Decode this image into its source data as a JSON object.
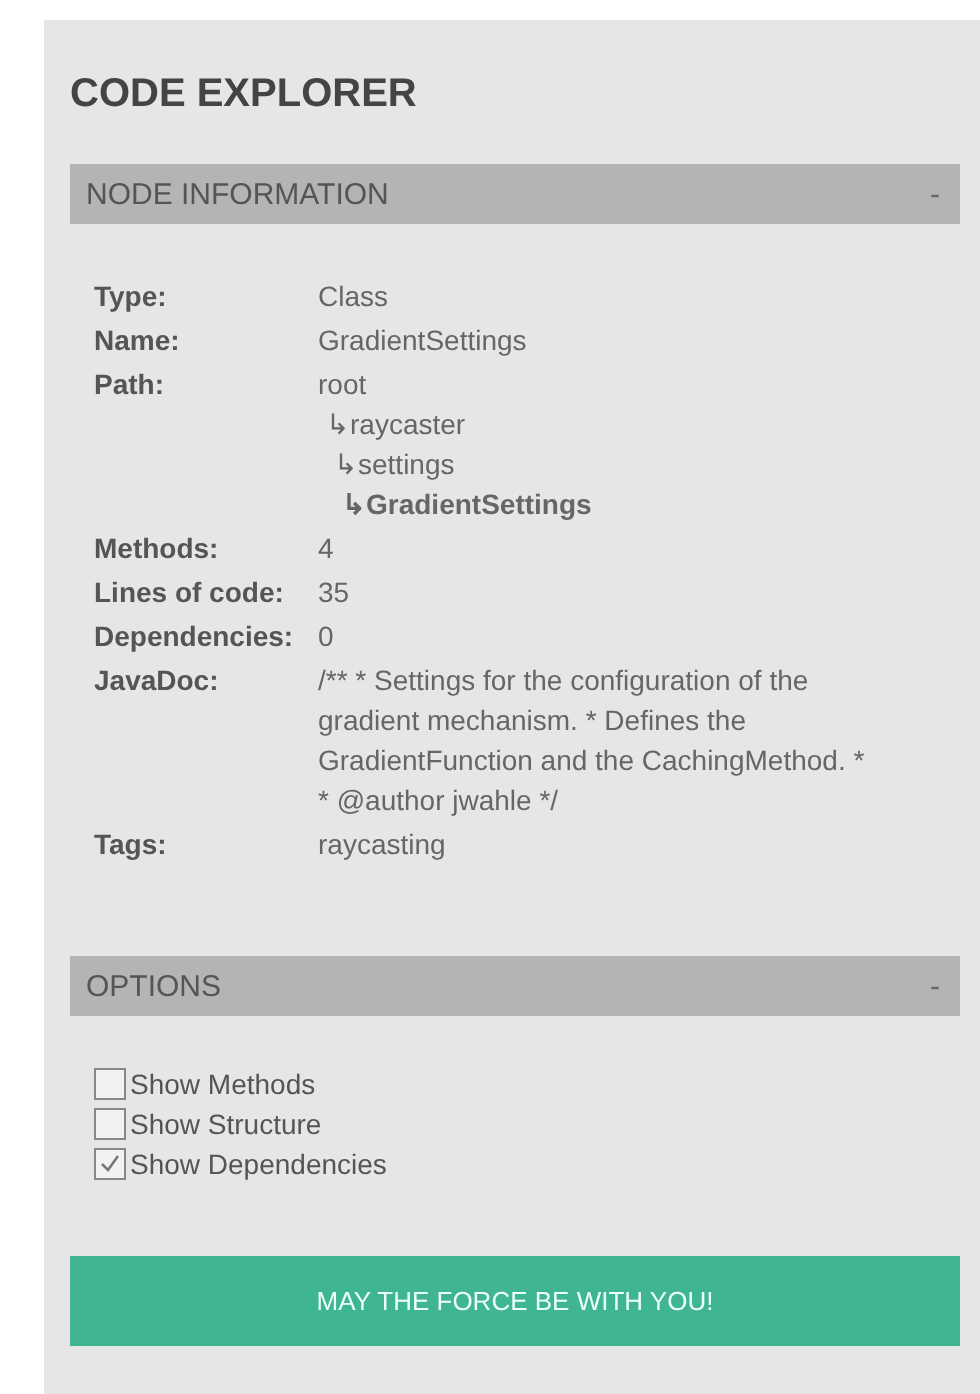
{
  "title": "CODE EXPLORER",
  "node_information": {
    "title": "NODE INFORMATION",
    "toggle": "-",
    "fields": [
      {
        "kind": "text",
        "label": "Type:",
        "value": "Class"
      },
      {
        "kind": "text",
        "label": "Name:",
        "value": "GradientSettings"
      },
      {
        "kind": "path",
        "label": "Path:",
        "path": [
          {
            "name": "root",
            "current": false,
            "children": [
              {
                "name": "↳raycaster",
                "current": false,
                "children": [
                  {
                    "name": "↳settings",
                    "current": false,
                    "children": [
                      {
                        "name": "↳GradientSettings",
                        "current": true
                      }
                    ]
                  }
                ]
              }
            ]
          }
        ]
      },
      {
        "kind": "text",
        "label": "Methods:",
        "value": "4"
      },
      {
        "kind": "text",
        "label": "Lines of code:",
        "value": "35"
      },
      {
        "kind": "text",
        "label": "Dependencies:",
        "value": "0"
      },
      {
        "kind": "text",
        "label": "JavaDoc:",
        "value": "/** * Settings for the configuration of the gradient mechanism. * Defines the GradientFunction and the CachingMethod. * * @author jwahle */"
      },
      {
        "kind": "text",
        "label": "Tags:",
        "value": "raycasting"
      }
    ]
  },
  "options": {
    "title": "OPTIONS",
    "toggle": "-",
    "items": [
      {
        "label": "Show Methods",
        "checked": false
      },
      {
        "label": "Show Structure",
        "checked": false
      },
      {
        "label": "Show Dependencies",
        "checked": true
      }
    ]
  },
  "button": "MAY THE FORCE BE WITH YOU!"
}
